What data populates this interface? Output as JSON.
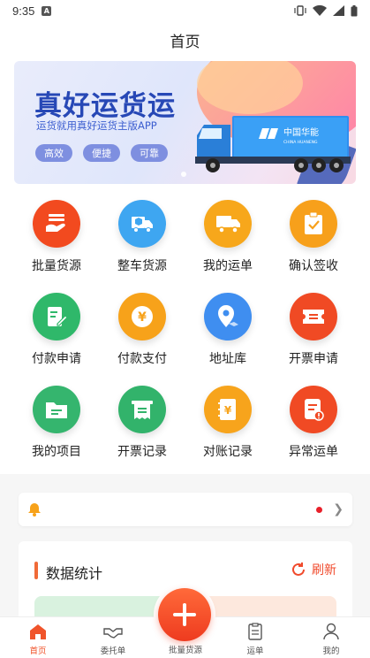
{
  "status_bar": {
    "time": "9:35"
  },
  "header": {
    "title": "首页"
  },
  "banner": {
    "title": "真好运货运",
    "subtitle": "运货就用真好运货主版APP",
    "tags": [
      "高效",
      "便捷",
      "可靠"
    ],
    "truck_brand": "中国华能",
    "truck_brand_en": "CHINA HUANENG"
  },
  "grid": [
    {
      "label": "批量货源",
      "icon": "bulk-cargo-icon",
      "color": "#f24a1f"
    },
    {
      "label": "整车货源",
      "icon": "truck-cargo-icon",
      "color": "#3ea6f1"
    },
    {
      "label": "我的运单",
      "icon": "truck-icon",
      "color": "#f7a71b"
    },
    {
      "label": "确认签收",
      "icon": "clipboard-check-icon",
      "color": "#f7a01b"
    },
    {
      "label": "付款申请",
      "icon": "edit-document-icon",
      "color": "#2fb86a"
    },
    {
      "label": "付款支付",
      "icon": "yuan-coin-icon",
      "color": "#f7a21a"
    },
    {
      "label": "地址库",
      "icon": "location-pin-icon",
      "color": "#3f8ef0"
    },
    {
      "label": "开票申请",
      "icon": "ticket-icon",
      "color": "#f04a24"
    },
    {
      "label": "我的项目",
      "icon": "folder-icon",
      "color": "#35b56e"
    },
    {
      "label": "开票记录",
      "icon": "receipt-icon",
      "color": "#32b36b"
    },
    {
      "label": "对账记录",
      "icon": "notebook-yuan-icon",
      "color": "#f7a41c"
    },
    {
      "label": "异常运单",
      "icon": "error-document-icon",
      "color": "#f04a24"
    }
  ],
  "notice": {
    "icon": "bell-icon"
  },
  "stats": {
    "title": "数据统计",
    "refresh_label": "刷新"
  },
  "tabbar": {
    "items": [
      {
        "label": "首页",
        "icon": "home-icon",
        "active": true
      },
      {
        "label": "委托单",
        "icon": "handshake-icon",
        "active": false
      },
      {
        "label": "批量货源",
        "icon": "plus-icon",
        "active": false
      },
      {
        "label": "运单",
        "icon": "clipboard-icon",
        "active": false
      },
      {
        "label": "我的",
        "icon": "user-icon",
        "active": false
      }
    ]
  },
  "colors": {
    "accent": "#f0542b"
  }
}
